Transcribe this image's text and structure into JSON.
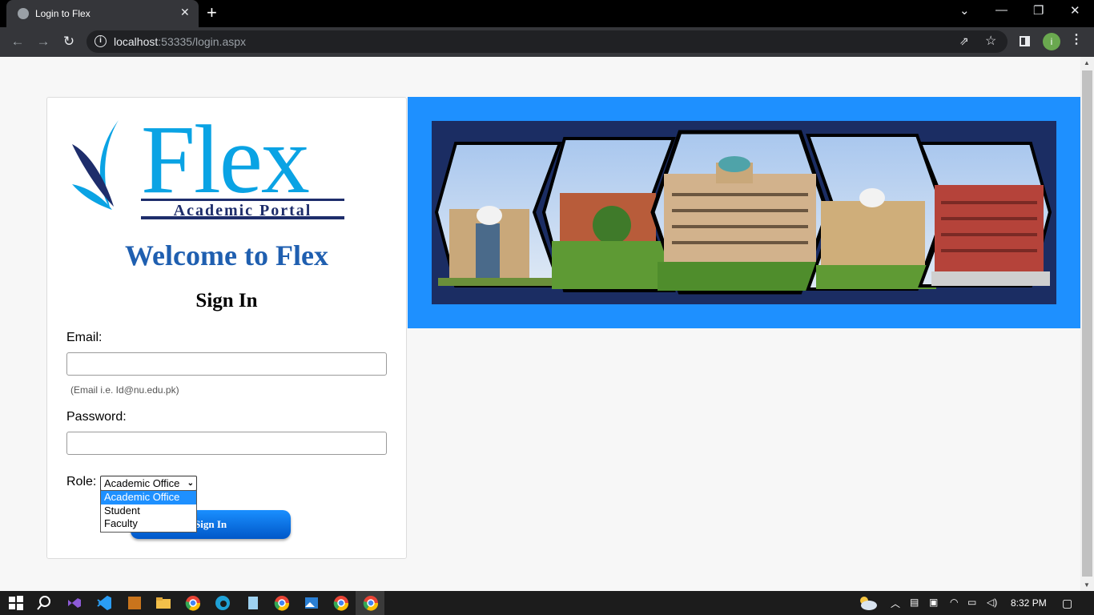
{
  "browser": {
    "tab_title": "Login to Flex",
    "tab_close": "✕",
    "new_tab": "+",
    "url_host": "localhost",
    "url_rest": ":53335/login.aspx",
    "profile_initial": "i",
    "window_controls": {
      "minimize": "—",
      "restore": "❐",
      "close": "✕",
      "tabsearch": "⌄"
    }
  },
  "logo": {
    "wordmark": "Flex",
    "tagline": "Academic Portal"
  },
  "login": {
    "welcome": "Welcome to Flex",
    "heading": "Sign In",
    "email_label": "Email:",
    "email_value": "",
    "email_hint": "(Email i.e. Id@nu.edu.pk)",
    "password_label": "Password:",
    "password_value": "",
    "role_label": "Role:",
    "role_selected": "Academic Office",
    "role_options": [
      "Academic Office",
      "Student",
      "Faculty"
    ],
    "signin_button": "Sign In"
  },
  "taskbar": {
    "clock": "8:32 PM"
  },
  "colors": {
    "banner_bg": "#1e90ff",
    "welcome_text": "#1f5fb0",
    "logo_cyan": "#0aa3e4",
    "logo_navy": "#1e2d6b",
    "button_gradient_top": "#1a8fff",
    "button_gradient_bottom": "#0057c8",
    "dropdown_selected": "#1e90ff"
  }
}
